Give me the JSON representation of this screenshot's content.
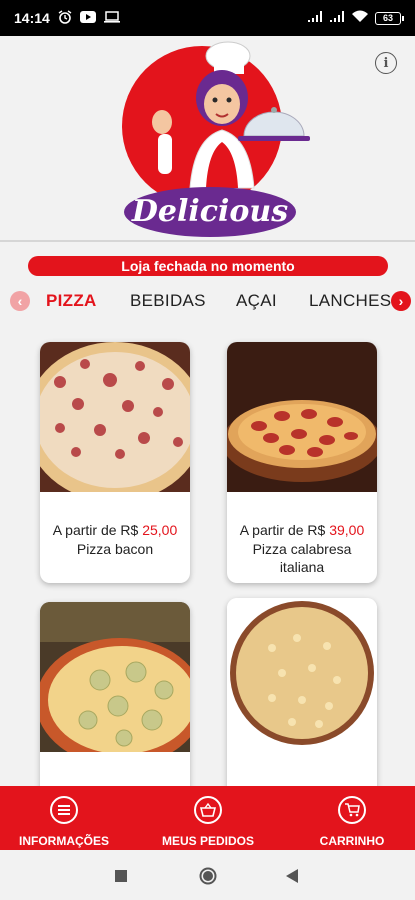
{
  "status_bar": {
    "time": "14:14",
    "battery": "63"
  },
  "header": {
    "logo_text": "Delicious",
    "info_icon": "info-icon"
  },
  "banner": {
    "text": "Loja fechada no momento"
  },
  "categories": {
    "tabs": [
      "PIZZA",
      "BEBIDAS",
      "AÇAI",
      "LANCHES"
    ],
    "active_index": 0
  },
  "products": [
    {
      "price_prefix": "A partir de R$ ",
      "price": "25,00",
      "name": "Pizza bacon"
    },
    {
      "price_prefix": "A partir de R$ ",
      "price": "39,00",
      "name": "Pizza calabresa italiana"
    },
    {
      "price_prefix": "",
      "price": "",
      "name": ""
    },
    {
      "price_prefix": "",
      "price": "",
      "name": ""
    }
  ],
  "bottom_nav": {
    "items": [
      "INFORMAÇÕES",
      "MEUS PEDIDOS",
      "CARRINHO"
    ]
  },
  "colors": {
    "accent": "#e3141c",
    "logo_purple": "#6a2a90"
  }
}
